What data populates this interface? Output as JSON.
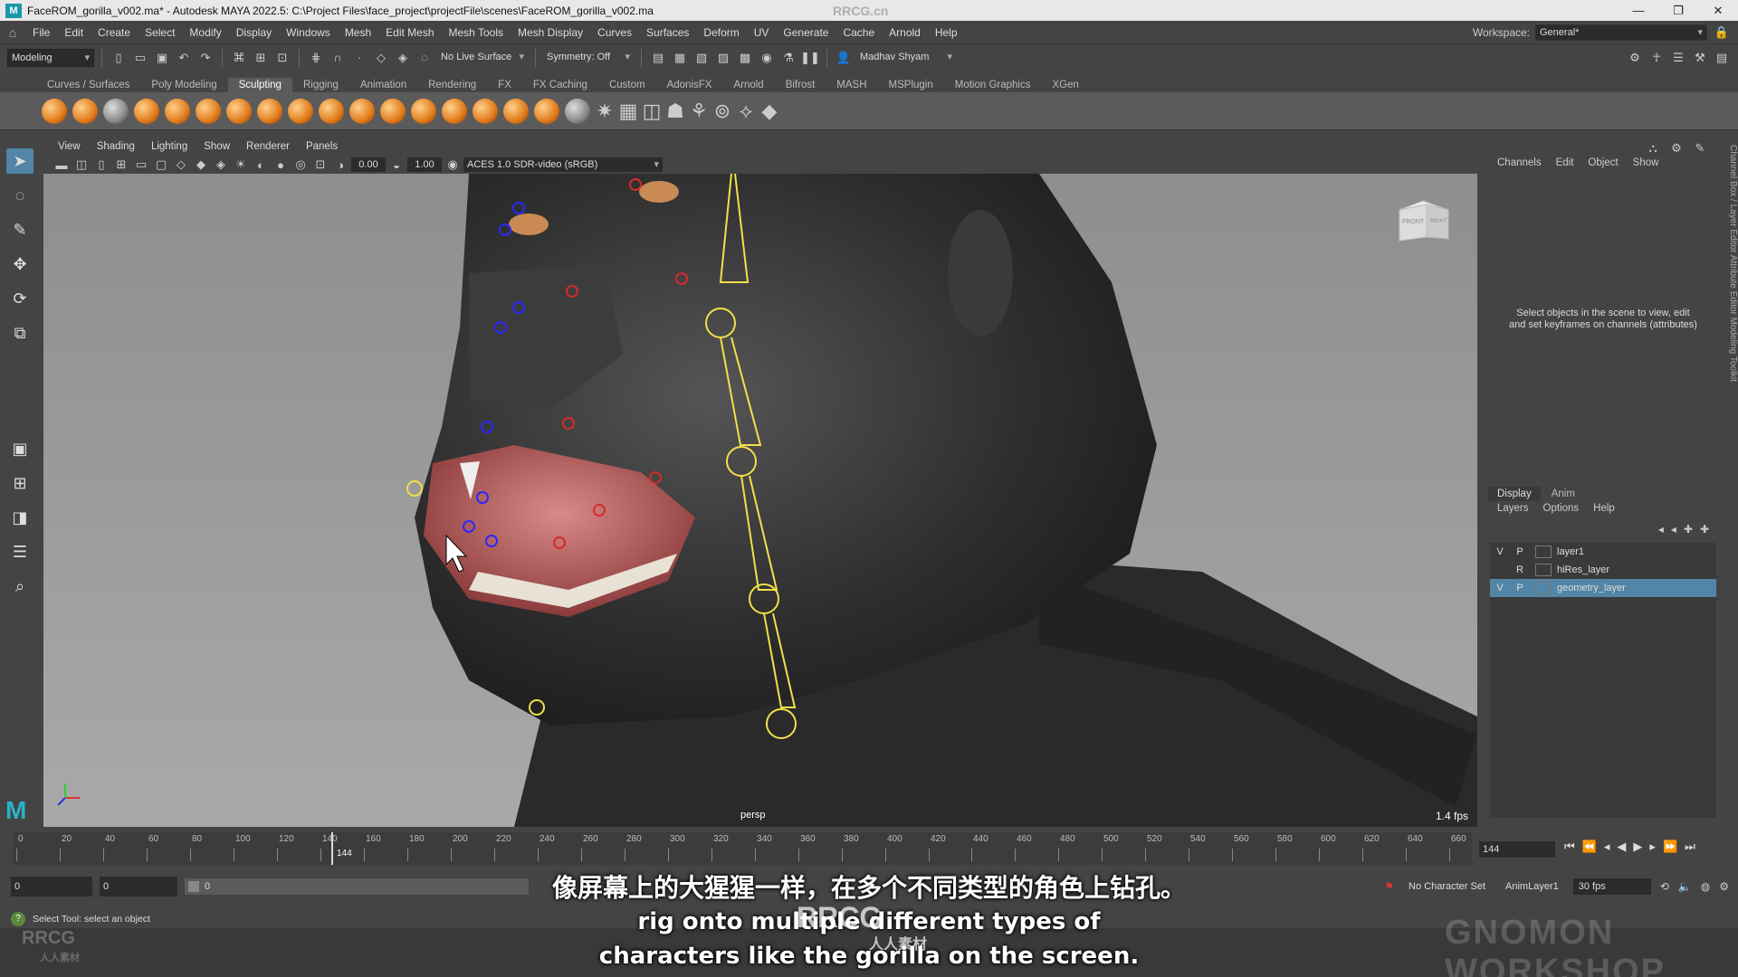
{
  "window": {
    "title": "FaceROM_gorilla_v002.ma* - Autodesk MAYA 2022.5: C:\\Project Files\\face_project\\projectFile\\scenes\\FaceROM_gorilla_v002.ma",
    "logo": "M",
    "minimize": "—",
    "maximize": "❐",
    "close": "✕"
  },
  "menu": {
    "items": [
      "File",
      "Edit",
      "Create",
      "Select",
      "Modify",
      "Display",
      "Windows",
      "Mesh",
      "Edit Mesh",
      "Mesh Tools",
      "Mesh Display",
      "Curves",
      "Surfaces",
      "Deform",
      "UV",
      "Generate",
      "Cache",
      "Arnold",
      "Help"
    ],
    "workspace_label": "Workspace:",
    "workspace_value": "General*"
  },
  "status_line": {
    "menuset": "Modeling",
    "live_surface": "No Live Surface",
    "symmetry": "Symmetry: Off",
    "user": "Madhav Shyam"
  },
  "shelf": {
    "tabs": [
      "Curves / Surfaces",
      "Poly Modeling",
      "Sculpting",
      "Rigging",
      "Animation",
      "Rendering",
      "FX",
      "FX Caching",
      "Custom",
      "AdonisFX",
      "Arnold",
      "Bifrost",
      "MASH",
      "MSPlugin",
      "Motion Graphics",
      "XGen"
    ],
    "active_tab": "Sculpting"
  },
  "panel": {
    "menu": [
      "View",
      "Shading",
      "Lighting",
      "Show",
      "Renderer",
      "Panels"
    ],
    "exposure": "0.00",
    "gamma": "1.00",
    "colorspace": "ACES 1.0 SDR-video (sRGB)",
    "camera_label": "persp",
    "fps": "1.4 fps",
    "viewcube_front": "FRONT",
    "viewcube_right": "RIGHT"
  },
  "channel_box": {
    "menu": [
      "Channels",
      "Edit",
      "Object",
      "Show"
    ],
    "message": "Select objects in the scene to view, edit and set keyframes on channels (attributes)",
    "side_tabs": "Channel Box / Layer Editor   Attribute Editor   Modeling Toolkit"
  },
  "layer_editor": {
    "tabs": [
      "Display",
      "Anim"
    ],
    "active_tab": "Display",
    "menu": [
      "Layers",
      "Options",
      "Help"
    ],
    "layers": [
      {
        "v": "V",
        "p": "P",
        "name": "layer1",
        "selected": false
      },
      {
        "v": "",
        "p": "R",
        "name": "hiRes_layer",
        "selected": false
      },
      {
        "v": "V",
        "p": "P",
        "name": "geometry_layer",
        "selected": true
      }
    ]
  },
  "timeline": {
    "ticks": [
      "0",
      "20",
      "40",
      "60",
      "80",
      "100",
      "120",
      "140",
      "160",
      "180",
      "200",
      "220",
      "240",
      "260",
      "280",
      "300",
      "320",
      "340",
      "360",
      "380",
      "400",
      "420",
      "440",
      "460",
      "480",
      "500",
      "520",
      "540",
      "560",
      "580",
      "600",
      "620",
      "640",
      "660"
    ],
    "current_frame": "144",
    "current_frame_box": "144"
  },
  "range": {
    "start": "0",
    "anim_start": "0",
    "range_label": "0",
    "character_set": "No Character Set",
    "anim_layer": "AnimLayer1",
    "fps": "30 fps"
  },
  "help_line": {
    "text": "Select Tool: select an object"
  },
  "subtitles": {
    "zh": "像屏幕上的大猩猩一样，在多个不同类型的角色上钻孔。",
    "en_line1": "rig onto multiple different types of",
    "en_line2": "characters like the gorilla on the screen."
  },
  "watermarks": {
    "top": "RRCG.cn",
    "center": "RRCG",
    "center_sub": "人人素材",
    "corner": "RRCG",
    "corner_sub": "人人素材",
    "workshop": "GNOMON WORKSHOP"
  }
}
